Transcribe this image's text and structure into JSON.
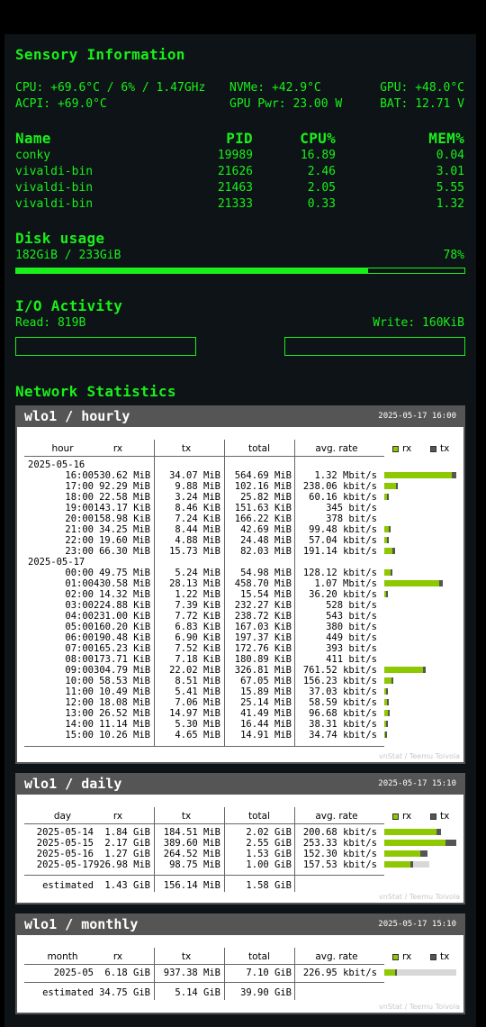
{
  "colors": {
    "accent": "#19f019",
    "bg": "#0d1317",
    "rx": "#8ec800",
    "tx": "#555555",
    "est": "#d8d8d8"
  },
  "sensory": {
    "title": "Sensory Information",
    "cpu": "CPU: +69.6°C / 6% / 1.47GHz",
    "nvme": "NVMe: +42.9°C",
    "gpu": "GPU: +48.0°C",
    "acpi": "ACPI: +69.0°C",
    "gpu_pwr": "GPU Pwr: 23.00 W",
    "bat": "BAT: 12.71 V"
  },
  "processes": {
    "headers": [
      "Name",
      "PID",
      "CPU%",
      "MEM%"
    ],
    "rows": [
      [
        "conky",
        "19989",
        "16.89",
        "0.04"
      ],
      [
        "vivaldi-bin",
        "21626",
        "2.46",
        "3.01"
      ],
      [
        "vivaldi-bin",
        "21463",
        "2.05",
        "5.55"
      ],
      [
        "vivaldi-bin",
        "21333",
        "0.33",
        "1.32"
      ]
    ]
  },
  "disk": {
    "title": "Disk usage",
    "used": "182GiB / 233GiB",
    "percent_label": "78%",
    "fraction": 0.78
  },
  "io": {
    "title": "I/O Activity",
    "read": "Read: 819B",
    "write": "Write: 160KiB",
    "read_fraction": 0,
    "write_fraction": 0
  },
  "network": {
    "title": "Network Statistics",
    "legend_rx": "rx",
    "legend_tx": "tx",
    "watermark": "vnStat / Teemu Toivola",
    "hourly": {
      "title": "wlo1 / hourly",
      "timestamp": "2025-05-17 16:00",
      "headers": [
        "hour",
        "rx",
        "tx",
        "total",
        "avg. rate"
      ],
      "rows": [
        {
          "date": "2025-05-16"
        },
        {
          "h": "16:00",
          "rx": "530.62 MiB",
          "tx": "34.07 MiB",
          "total": "564.69 MiB",
          "rate": "1.32 Mbit/s",
          "brx": 0.94,
          "btx": 0.06
        },
        {
          "h": "17:00",
          "rx": "92.29 MiB",
          "tx": "9.88 MiB",
          "total": "102.16 MiB",
          "rate": "238.06 kbit/s",
          "brx": 0.165,
          "btx": 0.018
        },
        {
          "h": "18:00",
          "rx": "22.58 MiB",
          "tx": "3.24 MiB",
          "total": "25.82 MiB",
          "rate": "60.16 kbit/s",
          "brx": 0.04,
          "btx": 0.006
        },
        {
          "h": "19:00",
          "rx": "143.17 KiB",
          "tx": "8.46 KiB",
          "total": "151.63 KiB",
          "rate": "345 bit/s",
          "brx": 0,
          "btx": 0
        },
        {
          "h": "20:00",
          "rx": "158.98 KiB",
          "tx": "7.24 KiB",
          "total": "166.22 KiB",
          "rate": "378 bit/s",
          "brx": 0,
          "btx": 0
        },
        {
          "h": "21:00",
          "rx": "34.25 MiB",
          "tx": "8.44 MiB",
          "total": "42.69 MiB",
          "rate": "99.48 kbit/s",
          "brx": 0.06,
          "btx": 0.015
        },
        {
          "h": "22:00",
          "rx": "19.60 MiB",
          "tx": "4.88 MiB",
          "total": "24.48 MiB",
          "rate": "57.04 kbit/s",
          "brx": 0.035,
          "btx": 0.009
        },
        {
          "h": "23:00",
          "rx": "66.30 MiB",
          "tx": "15.73 MiB",
          "total": "82.03 MiB",
          "rate": "191.14 kbit/s",
          "brx": 0.117,
          "btx": 0.028
        },
        {
          "date": "2025-05-17"
        },
        {
          "h": "00:00",
          "rx": "49.75 MiB",
          "tx": "5.24 MiB",
          "total": "54.98 MiB",
          "rate": "128.12 kbit/s",
          "brx": 0.088,
          "btx": 0.009
        },
        {
          "h": "01:00",
          "rx": "430.58 MiB",
          "tx": "28.13 MiB",
          "total": "458.70 MiB",
          "rate": "1.07 Mbit/s",
          "brx": 0.763,
          "btx": 0.05
        },
        {
          "h": "02:00",
          "rx": "14.32 MiB",
          "tx": "1.22 MiB",
          "total": "15.54 MiB",
          "rate": "36.20 kbit/s",
          "brx": 0.025,
          "btx": 0.002
        },
        {
          "h": "03:00",
          "rx": "224.88 KiB",
          "tx": "7.39 KiB",
          "total": "232.27 KiB",
          "rate": "528 bit/s",
          "brx": 0,
          "btx": 0
        },
        {
          "h": "04:00",
          "rx": "231.00 KiB",
          "tx": "7.72 KiB",
          "total": "238.72 KiB",
          "rate": "543 bit/s",
          "brx": 0,
          "btx": 0
        },
        {
          "h": "05:00",
          "rx": "160.20 KiB",
          "tx": "6.83 KiB",
          "total": "167.03 KiB",
          "rate": "380 bit/s",
          "brx": 0,
          "btx": 0
        },
        {
          "h": "06:00",
          "rx": "190.48 KiB",
          "tx": "6.90 KiB",
          "total": "197.37 KiB",
          "rate": "449 bit/s",
          "brx": 0,
          "btx": 0
        },
        {
          "h": "07:00",
          "rx": "165.23 KiB",
          "tx": "7.52 KiB",
          "total": "172.76 KiB",
          "rate": "393 bit/s",
          "brx": 0,
          "btx": 0
        },
        {
          "h": "08:00",
          "rx": "173.71 KiB",
          "tx": "7.18 KiB",
          "total": "180.89 KiB",
          "rate": "411 bit/s",
          "brx": 0,
          "btx": 0
        },
        {
          "h": "09:00",
          "rx": "304.79 MiB",
          "tx": "22.02 MiB",
          "total": "326.81 MiB",
          "rate": "761.52 kbit/s",
          "brx": 0.54,
          "btx": 0.039
        },
        {
          "h": "10:00",
          "rx": "58.53 MiB",
          "tx": "8.51 MiB",
          "total": "67.05 MiB",
          "rate": "156.23 kbit/s",
          "brx": 0.104,
          "btx": 0.015
        },
        {
          "h": "11:00",
          "rx": "10.49 MiB",
          "tx": "5.41 MiB",
          "total": "15.89 MiB",
          "rate": "37.03 kbit/s",
          "brx": 0.019,
          "btx": 0.01
        },
        {
          "h": "12:00",
          "rx": "18.08 MiB",
          "tx": "7.06 MiB",
          "total": "25.14 MiB",
          "rate": "58.59 kbit/s",
          "brx": 0.032,
          "btx": 0.013
        },
        {
          "h": "13:00",
          "rx": "26.52 MiB",
          "tx": "14.97 MiB",
          "total": "41.49 MiB",
          "rate": "96.68 kbit/s",
          "brx": 0.047,
          "btx": 0.027
        },
        {
          "h": "14:00",
          "rx": "11.14 MiB",
          "tx": "5.30 MiB",
          "total": "16.44 MiB",
          "rate": "38.31 kbit/s",
          "brx": 0.02,
          "btx": 0.009
        },
        {
          "h": "15:00",
          "rx": "10.26 MiB",
          "tx": "4.65 MiB",
          "total": "14.91 MiB",
          "rate": "34.74 kbit/s",
          "brx": 0.018,
          "btx": 0.008
        }
      ]
    },
    "daily": {
      "title": "wlo1 / daily",
      "timestamp": "2025-05-17 15:10",
      "headers": [
        "day",
        "rx",
        "tx",
        "total",
        "avg. rate"
      ],
      "rows": [
        {
          "h": "2025-05-14",
          "rx": "1.84 GiB",
          "tx": "184.51 MiB",
          "total": "2.02 GiB",
          "rate": "200.68 kbit/s",
          "brx": 0.72,
          "btx": 0.07
        },
        {
          "h": "2025-05-15",
          "rx": "2.17 GiB",
          "tx": "389.60 MiB",
          "total": "2.55 GiB",
          "rate": "253.33 kbit/s",
          "brx": 0.85,
          "btx": 0.15
        },
        {
          "h": "2025-05-16",
          "rx": "1.27 GiB",
          "tx": "264.52 MiB",
          "total": "1.53 GiB",
          "rate": "152.30 kbit/s",
          "brx": 0.5,
          "btx": 0.1
        },
        {
          "h": "2025-05-17",
          "rx": "926.98 MiB",
          "tx": "98.75 MiB",
          "total": "1.00 GiB",
          "rate": "157.53 kbit/s",
          "brx": 0.36,
          "btx": 0.04,
          "est": 0.62
        }
      ],
      "estimated": {
        "label": "estimated",
        "rx": "1.43 GiB",
        "tx": "156.14 MiB",
        "total": "1.58 GiB"
      }
    },
    "monthly": {
      "title": "wlo1 / monthly",
      "timestamp": "2025-05-17 15:10",
      "headers": [
        "month",
        "rx",
        "tx",
        "total",
        "avg. rate"
      ],
      "rows": [
        {
          "h": "2025-05",
          "rx": "6.18 GiB",
          "tx": "937.38 MiB",
          "total": "7.10 GiB",
          "rate": "226.95 kbit/s",
          "brx": 0.15,
          "btx": 0.02,
          "est": 1.0
        }
      ],
      "estimated": {
        "label": "estimated",
        "rx": "34.75 GiB",
        "tx": "5.14 GiB",
        "total": "39.90 GiB"
      }
    }
  }
}
